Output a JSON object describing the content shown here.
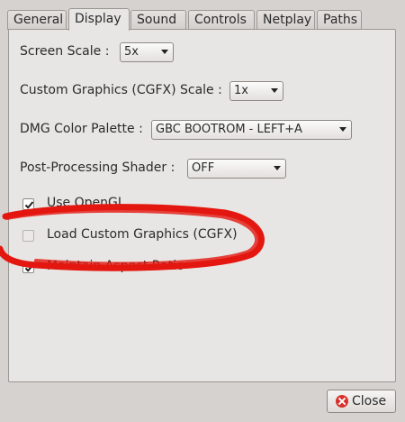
{
  "tabs": [
    "General",
    "Display",
    "Sound",
    "Controls",
    "Netplay",
    "Paths"
  ],
  "active_tab": "Display",
  "display": {
    "screen_scale": {
      "label": "Screen Scale :",
      "value": "5x"
    },
    "cgfx_scale": {
      "label": "Custom Graphics (CGFX) Scale :",
      "value": "1x"
    },
    "dmg_palette": {
      "label": "DMG Color Palette :",
      "value": "GBC BOOTROM - LEFT+A"
    },
    "shader": {
      "label": "Post-Processing Shader :",
      "value": "OFF"
    },
    "use_opengl": {
      "label": "Use OpenGL",
      "checked": true
    },
    "load_cgfx": {
      "label": "Load Custom Graphics (CGFX)",
      "checked": false
    },
    "aspect_ratio": {
      "label": "Maintain Aspect Ratio",
      "checked": true
    }
  },
  "buttons": {
    "close_label": "Close",
    "close_icon": "close-icon"
  },
  "colors": {
    "annotation_red": "#e3170f"
  }
}
